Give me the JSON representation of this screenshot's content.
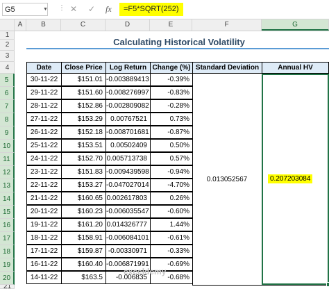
{
  "formula_bar": {
    "name_box": "G5",
    "dots": "⋮",
    "icons": [
      "dropdown-icon",
      "cancel-icon",
      "confirm-icon",
      "function-icon"
    ],
    "formula": "=F5*SQRT(252)"
  },
  "column_headers": [
    "A",
    "B",
    "C",
    "D",
    "E",
    "F",
    "G"
  ],
  "selected_column": "G",
  "row_numbers": [
    "1",
    "2",
    "3",
    "4",
    "5",
    "6",
    "7",
    "8",
    "9",
    "10",
    "11",
    "12",
    "13",
    "14",
    "15",
    "16",
    "17",
    "18",
    "19",
    "20",
    "21"
  ],
  "selected_row": "5",
  "sheet": {
    "title": "Calculating Historical Volatility",
    "headers": [
      "Date",
      "Close Price",
      "Log Return",
      "Change (%)",
      "Standard Deviation",
      "Annual HV"
    ],
    "rows": [
      {
        "date": "30-11-22",
        "close": "$151.01",
        "log": "-0.003889413",
        "chg": "-0.39%"
      },
      {
        "date": "29-11-22",
        "close": "$151.60",
        "log": "-0.008276997",
        "chg": "-0.83%"
      },
      {
        "date": "28-11-22",
        "close": "$152.86",
        "log": "-0.002809082",
        "chg": "-0.28%"
      },
      {
        "date": "27-11-22",
        "close": "$153.29",
        "log": "0.00767521",
        "chg": "0.73%"
      },
      {
        "date": "26-11-22",
        "close": "$152.18",
        "log": "-0.008701681",
        "chg": "-0.87%"
      },
      {
        "date": "25-11-22",
        "close": "$153.51",
        "log": "0.00502409",
        "chg": "0.50%"
      },
      {
        "date": "24-11-22",
        "close": "$152.70",
        "log": "0.005713738",
        "chg": "0.57%"
      },
      {
        "date": "23-11-22",
        "close": "$151.83",
        "log": "-0.009439598",
        "chg": "-0.94%"
      },
      {
        "date": "22-11-22",
        "close": "$153.27",
        "log": "-0.047027014",
        "chg": "-4.70%"
      },
      {
        "date": "21-11-22",
        "close": "$160.65",
        "log": "0.002617803",
        "chg": "0.26%"
      },
      {
        "date": "20-11-22",
        "close": "$160.23",
        "log": "-0.006035547",
        "chg": "-0.60%"
      },
      {
        "date": "19-11-22",
        "close": "$161.20",
        "log": "0.014326777",
        "chg": "1.44%"
      },
      {
        "date": "18-11-22",
        "close": "$158.91",
        "log": "-0.006084101",
        "chg": "-0.61%"
      },
      {
        "date": "17-11-22",
        "close": "$159.87",
        "log": "-0.00330971",
        "chg": "-0.33%"
      },
      {
        "date": "16-11-22",
        "close": "$160.40",
        "log": "-0.006871991",
        "chg": "-0.69%"
      },
      {
        "date": "14-11-22",
        "close": "$163.5",
        "log": "-0.006835",
        "chg": "-0.68%"
      }
    ],
    "std_dev": "0.013052567",
    "annual_hv": "0.207203084"
  },
  "watermark": "exceldemy",
  "colors": {
    "header_fill": "#deebf7",
    "highlight": "#ffff00",
    "selection": "#217346",
    "title": "#2f4a66",
    "title_line": "#5a9bd5"
  }
}
